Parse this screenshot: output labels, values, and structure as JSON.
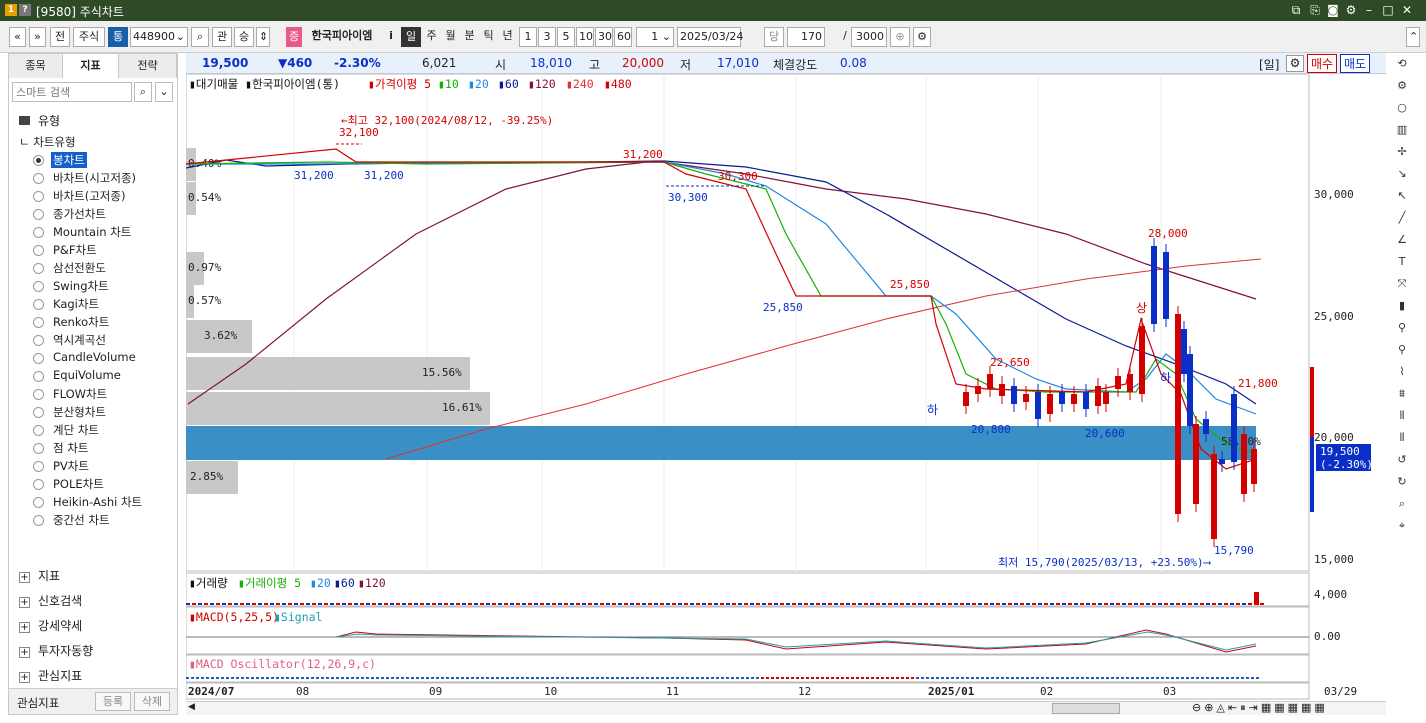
{
  "window": {
    "badge1": "1",
    "badge2": "?",
    "title": "[9580] 주식차트"
  },
  "toolbar": {
    "nav_prev": "«",
    "nav_down": "»",
    "btn_jeon": "전",
    "btn_jusik": "주식",
    "btn_tong": "통",
    "code": "448900",
    "btn_gwan": "관",
    "btn_seung": "승",
    "btn_jeung": "증",
    "stock_name": "한국피아이엠",
    "btn_i": "i",
    "periods": [
      "일",
      "주",
      "월",
      "분",
      "틱",
      "년"
    ],
    "intervals": [
      "1",
      "3",
      "5",
      "10",
      "30",
      "60"
    ],
    "count_field": "1",
    "date": "2025/03/24",
    "btn_dang": "당",
    "bars": "170",
    "slash": "/",
    "max_bars": "3000"
  },
  "left": {
    "tabs": [
      "종목",
      "지표",
      "전략"
    ],
    "search_placeholder": "스마트 검색",
    "cat_type": "유형",
    "cat_chart": "차트유형",
    "items": [
      "봉차트",
      "바차트(시고저종)",
      "바차트(고저종)",
      "종가선차트",
      "Mountain 차트",
      "P&F차트",
      "삼선전환도",
      "Swing차트",
      "Kagi차트",
      "Renko차트",
      "역시계곡선",
      "CandleVolume",
      "EquiVolume",
      "FLOW차트",
      "분산형차트",
      "계단 차트",
      "점 차트",
      "PV차트",
      "POLE차트",
      "Heikin-Ashi 차트",
      "중간선 차트"
    ],
    "sections": [
      "지표",
      "신호검색",
      "강세약세",
      "투자자동향",
      "관심지표"
    ],
    "bottom_label": "관심지표",
    "btn_register": "등록",
    "btn_delete": "삭제"
  },
  "info": {
    "price": "19,500",
    "change": "▼460",
    "pct": "-2.30%",
    "volume": "6,021",
    "open_lbl": "시",
    "open": "18,010",
    "high_lbl": "고",
    "high": "20,000",
    "low_lbl": "저",
    "low": "17,010",
    "strength_lbl": "체결강도",
    "strength": "0.08",
    "period": "[일]",
    "buy": "매수",
    "sell": "매도"
  },
  "legend": {
    "supply": "대기매물",
    "name": "한국피아이엠(통)",
    "ma_label": "가격이평",
    "ma": [
      "5",
      "10",
      "20",
      "60",
      "120",
      "240",
      "480"
    ],
    "volume": "거래량",
    "vol_ma_label": "거래이평",
    "vol_ma": [
      "5",
      "20",
      "60",
      "120"
    ],
    "macd": "MACD(5,25,5)",
    "signal": "Signal",
    "osc": "MACD Oscillator(12,26,9,c)"
  },
  "annotations": {
    "high_note": "←최고 32,100(2024/08/12, -39.25%)",
    "low_note": "최저 15,790(2025/03/13, +23.50%)⟶",
    "labels": [
      "32,100",
      "31,200",
      "31,200",
      "31,200",
      "30,300",
      "30,300",
      "25,850",
      "25,850",
      "22,650",
      "20,800",
      "20,600",
      "28,000",
      "21,800",
      "15,790",
      "58.80%"
    ],
    "markers": [
      "하",
      "하",
      "상"
    ],
    "supply_pct": [
      "0.40%",
      "0.54%",
      "0.97%",
      "0.57%",
      "3.62%",
      "15.56%",
      "16.61%",
      "58.80%",
      "2.85%"
    ]
  },
  "axis": {
    "prices": [
      "30,000",
      "25,000",
      "20,000",
      "15,000"
    ],
    "current": "19,500",
    "current_pct": "(-2.30%)",
    "vol_tick": "4,000",
    "macd_tick": "0.00",
    "months": [
      "2024/07",
      "08",
      "09",
      "10",
      "11",
      "12",
      "2025/01",
      "02",
      "03"
    ],
    "last_date": "03/29"
  },
  "colors": {
    "up": "#d40000",
    "down": "#0a2fc8",
    "supply_bar": "#c8c8c8",
    "supply_hl": "#3a8fc4",
    "ma5": "#d40000",
    "ma10": "#16b000",
    "ma20": "#1e88e5",
    "ma60": "#0a1a90",
    "ma120": "#801040",
    "ma240": "#e03030"
  }
}
